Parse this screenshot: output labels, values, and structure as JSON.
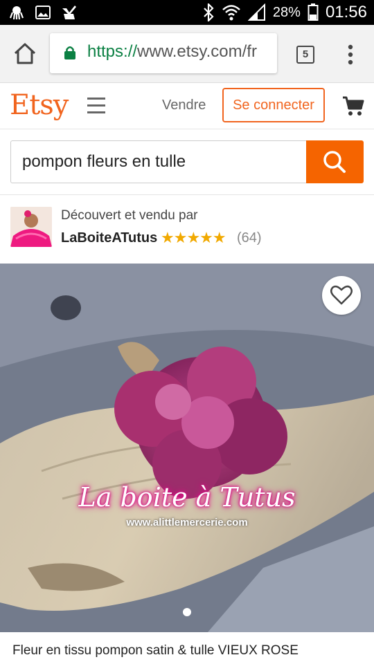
{
  "status_bar": {
    "battery": "28%",
    "time": "01:56"
  },
  "browser": {
    "url_scheme": "https://",
    "url_host": "www.etsy.com/fr",
    "tab_count": "5"
  },
  "header": {
    "logo": "Etsy",
    "sell_label": "Vendre",
    "signin_label": "Se connecter",
    "accent_color": "#f1641e"
  },
  "search": {
    "query": "pompon fleurs en tulle"
  },
  "seller": {
    "intro": "Découvert et vendu par",
    "name": "LaBoiteATutus",
    "stars": "★★★★★",
    "rating": 5,
    "review_count": "(64)"
  },
  "hero": {
    "watermark_brand": "La boite à Tutus",
    "watermark_url": "www.alittlemercerie.com",
    "carousel_index": 1
  },
  "listing": {
    "title": "Fleur en tissu pompon satin & tulle VIEUX ROSE"
  }
}
